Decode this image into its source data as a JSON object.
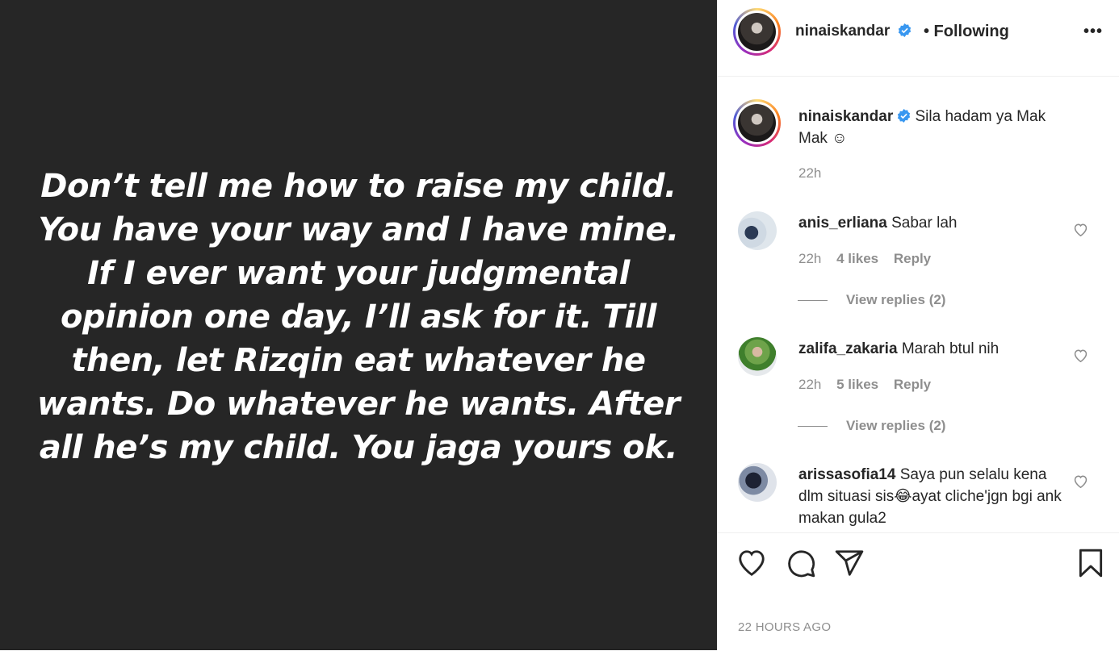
{
  "media": {
    "text": "Don’t tell me how to raise my child. You have your way and I have mine. If I ever want your judgmental opinion one day, I’ll ask for it. Till then, let Rizqin eat whatever he wants. Do whatever he wants. After all he’s my child. You jaga yours ok."
  },
  "header": {
    "username": "ninaiskandar",
    "following_label": "• Following",
    "more_label": "•••"
  },
  "caption": {
    "username": "ninaiskandar",
    "text": "Sila hadam ya Mak Mak ☺",
    "time": "22h"
  },
  "comments": [
    {
      "username": "anis_erliana",
      "text": "Sabar lah",
      "time": "22h",
      "likes": "4 likes",
      "reply_label": "Reply",
      "view_replies": "View replies (2)"
    },
    {
      "username": "zalifa_zakaria",
      "text": "Marah btul nih",
      "time": "22h",
      "likes": "5 likes",
      "reply_label": "Reply",
      "view_replies": "View replies (2)"
    },
    {
      "username": "arissasofia14",
      "text": "Saya pun selalu kena dlm situasi sis😂ayat cliche'jgn bgi ank makan gula2"
    }
  ],
  "footer": {
    "timestamp": "22 HOURS AGO"
  },
  "icons": {
    "like": "heart-icon",
    "comment": "comment-bubble-icon",
    "share": "paper-plane-icon",
    "save": "bookmark-icon",
    "verified": "verified-badge-icon"
  },
  "colors": {
    "media_bg": "#262626",
    "verified_blue": "#3897f0",
    "muted_text": "#8e8e8e"
  }
}
